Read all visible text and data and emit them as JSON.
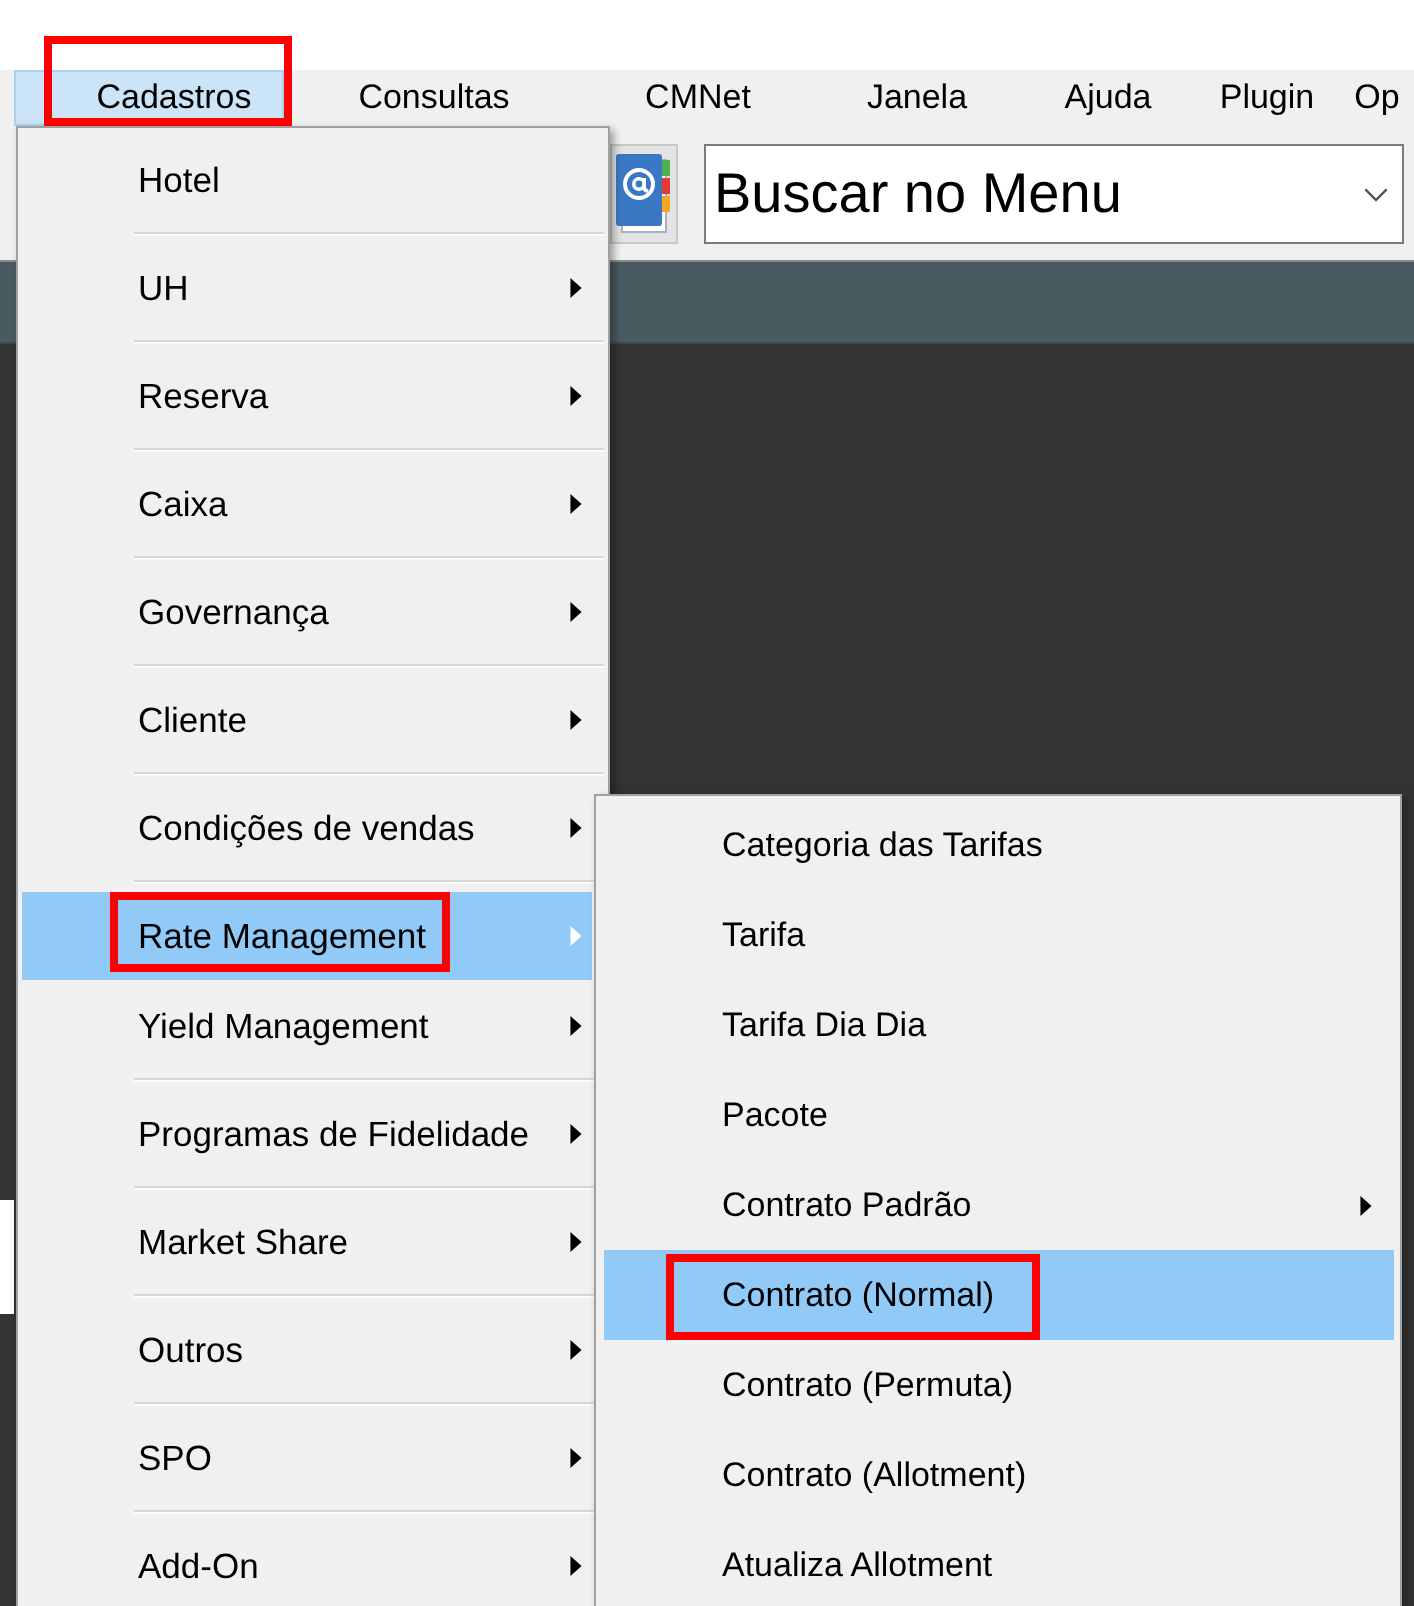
{
  "menu_bar": {
    "items": [
      {
        "label": "Cadastros",
        "selected": true,
        "annotated": true
      },
      {
        "label": "Consultas",
        "selected": false,
        "annotated": false
      },
      {
        "label": "CMNet",
        "selected": false,
        "annotated": false
      },
      {
        "label": "Janela",
        "selected": false,
        "annotated": false
      },
      {
        "label": "Ajuda",
        "selected": false,
        "annotated": false
      },
      {
        "label": "Plugin",
        "selected": false,
        "annotated": false
      },
      {
        "label": "Op",
        "selected": false,
        "annotated": false
      }
    ]
  },
  "toolbar": {
    "search": {
      "placeholder": "Buscar no Menu"
    }
  },
  "menu": {
    "items": [
      {
        "label": "Hotel",
        "has_submenu": false,
        "selected": false,
        "annotated": false
      },
      {
        "label": "UH",
        "has_submenu": true,
        "selected": false,
        "annotated": false
      },
      {
        "label": "Reserva",
        "has_submenu": true,
        "selected": false,
        "annotated": false
      },
      {
        "label": "Caixa",
        "has_submenu": true,
        "selected": false,
        "annotated": false
      },
      {
        "label": "Governança",
        "has_submenu": true,
        "selected": false,
        "annotated": false
      },
      {
        "label": "Cliente",
        "has_submenu": true,
        "selected": false,
        "annotated": false
      },
      {
        "label": "Condições de vendas",
        "has_submenu": true,
        "selected": false,
        "annotated": false
      },
      {
        "label": "Rate Management",
        "has_submenu": true,
        "selected": true,
        "annotated": true
      },
      {
        "label": "Yield Management",
        "has_submenu": true,
        "selected": false,
        "annotated": false
      },
      {
        "label": "Programas de Fidelidade",
        "has_submenu": true,
        "selected": false,
        "annotated": false
      },
      {
        "label": "Market Share",
        "has_submenu": true,
        "selected": false,
        "annotated": false
      },
      {
        "label": "Outros",
        "has_submenu": true,
        "selected": false,
        "annotated": false
      },
      {
        "label": "SPO",
        "has_submenu": true,
        "selected": false,
        "annotated": false
      },
      {
        "label": "Add-On",
        "has_submenu": true,
        "selected": false,
        "annotated": false
      }
    ]
  },
  "submenu": {
    "items": [
      {
        "label": "Categoria das Tarifas",
        "has_submenu": false,
        "selected": false,
        "annotated": false
      },
      {
        "label": "Tarifa",
        "has_submenu": false,
        "selected": false,
        "annotated": false
      },
      {
        "label": "Tarifa Dia Dia",
        "has_submenu": false,
        "selected": false,
        "annotated": false
      },
      {
        "label": "Pacote",
        "has_submenu": false,
        "selected": false,
        "annotated": false
      },
      {
        "label": "Contrato Padrão",
        "has_submenu": true,
        "selected": false,
        "annotated": false
      },
      {
        "label": "Contrato (Normal)",
        "has_submenu": false,
        "selected": true,
        "annotated": true
      },
      {
        "label": "Contrato (Permuta)",
        "has_submenu": false,
        "selected": false,
        "annotated": false
      },
      {
        "label": "Contrato (Allotment)",
        "has_submenu": false,
        "selected": false,
        "annotated": false
      },
      {
        "label": "Atualiza Allotment",
        "has_submenu": false,
        "selected": false,
        "annotated": false
      }
    ]
  }
}
